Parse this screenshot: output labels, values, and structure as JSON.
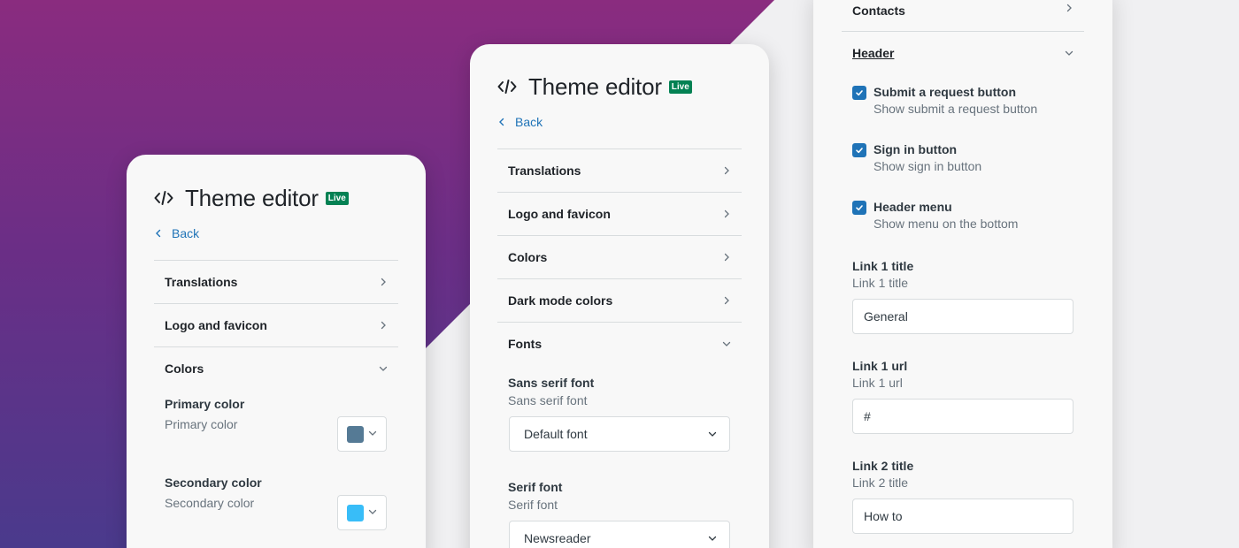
{
  "colors": {
    "primary_swatch": "#557a95",
    "secondary_swatch": "#38bdf8",
    "live_badge": "#038153",
    "accent": "#1f73b7"
  },
  "left_card": {
    "title": "Theme editor",
    "live": "Live",
    "back": "Back",
    "items": [
      "Translations",
      "Logo and favicon",
      "Colors"
    ],
    "primary_label": "Primary color",
    "primary_hint": "Primary color",
    "secondary_label": "Secondary color",
    "secondary_hint": "Secondary color"
  },
  "mid_card": {
    "title": "Theme editor",
    "live": "Live",
    "back": "Back",
    "items": [
      "Translations",
      "Logo and favicon",
      "Colors",
      "Dark mode colors",
      "Fonts"
    ],
    "sans_label": "Sans serif font",
    "sans_hint": "Sans serif font",
    "sans_value": "Default font",
    "serif_label": "Serif font",
    "serif_hint": "Serif font",
    "serif_value": "Newsreader"
  },
  "right_panel": {
    "contacts": "Contacts",
    "header": "Header",
    "checks": [
      {
        "label": "Submit a request button",
        "hint": "Show submit a request button"
      },
      {
        "label": "Sign in button",
        "hint": "Show sign in button"
      },
      {
        "label": "Header menu",
        "hint": "Show menu on the bottom"
      }
    ],
    "links": [
      {
        "label": "Link 1 title",
        "hint": "Link 1 title",
        "value": "General"
      },
      {
        "label": "Link 1 url",
        "hint": "Link 1 url",
        "value": "#"
      },
      {
        "label": "Link 2 title",
        "hint": "Link 2 title",
        "value": "How to"
      }
    ]
  },
  "icons": {
    "code": "code-icon",
    "chevron_left": "chevron-left-icon",
    "chevron_right": "chevron-right-icon",
    "chevron_down": "chevron-down-icon",
    "check": "check-icon"
  }
}
